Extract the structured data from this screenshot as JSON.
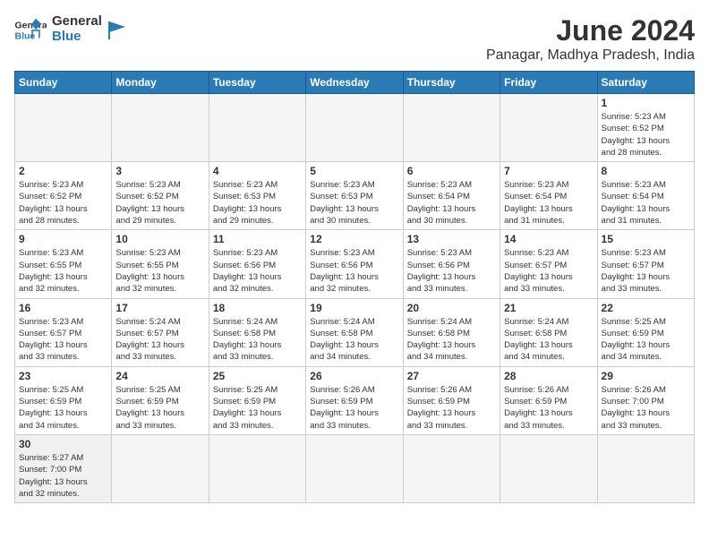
{
  "header": {
    "logo_general": "General",
    "logo_blue": "Blue",
    "title": "June 2024",
    "subtitle": "Panagar, Madhya Pradesh, India"
  },
  "weekdays": [
    "Sunday",
    "Monday",
    "Tuesday",
    "Wednesday",
    "Thursday",
    "Friday",
    "Saturday"
  ],
  "weeks": [
    [
      {
        "day": "",
        "info": ""
      },
      {
        "day": "",
        "info": ""
      },
      {
        "day": "",
        "info": ""
      },
      {
        "day": "",
        "info": ""
      },
      {
        "day": "",
        "info": ""
      },
      {
        "day": "",
        "info": ""
      },
      {
        "day": "1",
        "info": "Sunrise: 5:23 AM\nSunset: 6:52 PM\nDaylight: 13 hours\nand 28 minutes."
      }
    ],
    [
      {
        "day": "2",
        "info": "Sunrise: 5:23 AM\nSunset: 6:52 PM\nDaylight: 13 hours\nand 28 minutes."
      },
      {
        "day": "3",
        "info": "Sunrise: 5:23 AM\nSunset: 6:52 PM\nDaylight: 13 hours\nand 29 minutes."
      },
      {
        "day": "4",
        "info": "Sunrise: 5:23 AM\nSunset: 6:53 PM\nDaylight: 13 hours\nand 29 minutes."
      },
      {
        "day": "5",
        "info": "Sunrise: 5:23 AM\nSunset: 6:53 PM\nDaylight: 13 hours\nand 30 minutes."
      },
      {
        "day": "6",
        "info": "Sunrise: 5:23 AM\nSunset: 6:54 PM\nDaylight: 13 hours\nand 30 minutes."
      },
      {
        "day": "7",
        "info": "Sunrise: 5:23 AM\nSunset: 6:54 PM\nDaylight: 13 hours\nand 31 minutes."
      },
      {
        "day": "8",
        "info": "Sunrise: 5:23 AM\nSunset: 6:54 PM\nDaylight: 13 hours\nand 31 minutes."
      }
    ],
    [
      {
        "day": "9",
        "info": "Sunrise: 5:23 AM\nSunset: 6:55 PM\nDaylight: 13 hours\nand 32 minutes."
      },
      {
        "day": "10",
        "info": "Sunrise: 5:23 AM\nSunset: 6:55 PM\nDaylight: 13 hours\nand 32 minutes."
      },
      {
        "day": "11",
        "info": "Sunrise: 5:23 AM\nSunset: 6:56 PM\nDaylight: 13 hours\nand 32 minutes."
      },
      {
        "day": "12",
        "info": "Sunrise: 5:23 AM\nSunset: 6:56 PM\nDaylight: 13 hours\nand 32 minutes."
      },
      {
        "day": "13",
        "info": "Sunrise: 5:23 AM\nSunset: 6:56 PM\nDaylight: 13 hours\nand 33 minutes."
      },
      {
        "day": "14",
        "info": "Sunrise: 5:23 AM\nSunset: 6:57 PM\nDaylight: 13 hours\nand 33 minutes."
      },
      {
        "day": "15",
        "info": "Sunrise: 5:23 AM\nSunset: 6:57 PM\nDaylight: 13 hours\nand 33 minutes."
      }
    ],
    [
      {
        "day": "16",
        "info": "Sunrise: 5:23 AM\nSunset: 6:57 PM\nDaylight: 13 hours\nand 33 minutes."
      },
      {
        "day": "17",
        "info": "Sunrise: 5:24 AM\nSunset: 6:57 PM\nDaylight: 13 hours\nand 33 minutes."
      },
      {
        "day": "18",
        "info": "Sunrise: 5:24 AM\nSunset: 6:58 PM\nDaylight: 13 hours\nand 33 minutes."
      },
      {
        "day": "19",
        "info": "Sunrise: 5:24 AM\nSunset: 6:58 PM\nDaylight: 13 hours\nand 34 minutes."
      },
      {
        "day": "20",
        "info": "Sunrise: 5:24 AM\nSunset: 6:58 PM\nDaylight: 13 hours\nand 34 minutes."
      },
      {
        "day": "21",
        "info": "Sunrise: 5:24 AM\nSunset: 6:58 PM\nDaylight: 13 hours\nand 34 minutes."
      },
      {
        "day": "22",
        "info": "Sunrise: 5:25 AM\nSunset: 6:59 PM\nDaylight: 13 hours\nand 34 minutes."
      }
    ],
    [
      {
        "day": "23",
        "info": "Sunrise: 5:25 AM\nSunset: 6:59 PM\nDaylight: 13 hours\nand 34 minutes."
      },
      {
        "day": "24",
        "info": "Sunrise: 5:25 AM\nSunset: 6:59 PM\nDaylight: 13 hours\nand 33 minutes."
      },
      {
        "day": "25",
        "info": "Sunrise: 5:25 AM\nSunset: 6:59 PM\nDaylight: 13 hours\nand 33 minutes."
      },
      {
        "day": "26",
        "info": "Sunrise: 5:26 AM\nSunset: 6:59 PM\nDaylight: 13 hours\nand 33 minutes."
      },
      {
        "day": "27",
        "info": "Sunrise: 5:26 AM\nSunset: 6:59 PM\nDaylight: 13 hours\nand 33 minutes."
      },
      {
        "day": "28",
        "info": "Sunrise: 5:26 AM\nSunset: 6:59 PM\nDaylight: 13 hours\nand 33 minutes."
      },
      {
        "day": "29",
        "info": "Sunrise: 5:26 AM\nSunset: 7:00 PM\nDaylight: 13 hours\nand 33 minutes."
      }
    ],
    [
      {
        "day": "30",
        "info": "Sunrise: 5:27 AM\nSunset: 7:00 PM\nDaylight: 13 hours\nand 32 minutes."
      },
      {
        "day": "",
        "info": ""
      },
      {
        "day": "",
        "info": ""
      },
      {
        "day": "",
        "info": ""
      },
      {
        "day": "",
        "info": ""
      },
      {
        "day": "",
        "info": ""
      },
      {
        "day": "",
        "info": ""
      }
    ]
  ]
}
